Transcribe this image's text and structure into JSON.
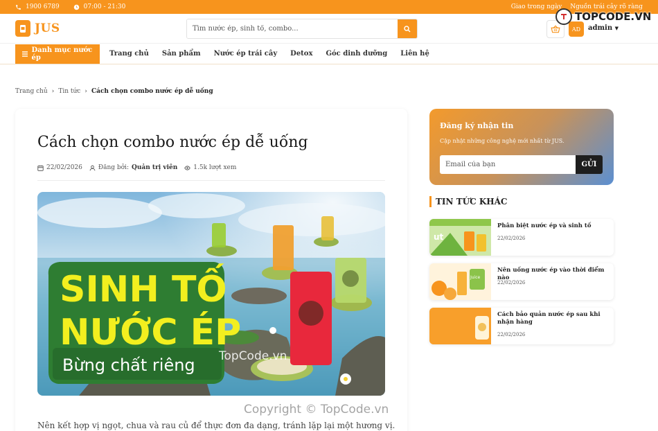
{
  "topbar": {
    "phone": "1900 6789",
    "hours": "07:00 - 21:30",
    "links": [
      "Giao trong ngày",
      "Nguồn trái cây rõ ràng"
    ]
  },
  "header": {
    "brand": "JUS",
    "search_placeholder": "Tìm nước ép, sinh tố, combo...",
    "avatar_initials": "AD",
    "user_name": "admin"
  },
  "nav": {
    "category_button": "Danh mục nước ép",
    "links": [
      "Trang chủ",
      "Sản phẩm",
      "Nước ép trái cây",
      "Detox",
      "Góc dinh dưỡng",
      "Liên hệ"
    ]
  },
  "breadcrumb": {
    "items": [
      "Trang chủ",
      "Tin tức"
    ],
    "current": "Cách chọn combo nước ép dễ uống"
  },
  "article": {
    "title": "Cách chọn combo nước ép dễ uống",
    "date": "22/02/2026",
    "author_label": "Đăng bởi:",
    "author": "Quản trị viên",
    "views": "1.5k lượt xem",
    "hero": {
      "line1": "SINH TỐ",
      "line2": "NƯỚC ÉP",
      "line3": "Bừng chất riêng"
    },
    "body": "Nên kết hợp vị ngọt, chua và rau củ để thực đơn đa dạng, tránh lặp lại một hương vị."
  },
  "sidebar": {
    "newsletter": {
      "title": "Đăng ký nhận tin",
      "subtitle": "Cập nhật những công nghệ mới nhất từ JUS.",
      "email_placeholder": "Email của bạn",
      "button": "GỬI"
    },
    "other_news_title": "TIN TỨC KHÁC",
    "news": [
      {
        "title": "Phân biệt nước ép và sinh tố",
        "date": "22/02/2026"
      },
      {
        "title": "Nên uống nước ép vào thời điểm nào",
        "date": "22/02/2026"
      },
      {
        "title": "Cách bảo quản nước ép sau khi nhận hàng",
        "date": "22/02/2026"
      }
    ]
  },
  "watermark": {
    "logo_text": "TOPCODE.VN",
    "image_text": "TopCode.vn",
    "copyright": "Copyright © TopCode.vn"
  },
  "colors": {
    "accent": "#f7941d",
    "hero_green": "#2e7d32",
    "hero_yellow": "#f2ef1f",
    "dark_button": "#1e1e1e"
  },
  "icons": [
    "phone-icon",
    "clock-icon",
    "cup-icon",
    "search-icon",
    "basket-icon",
    "caret-down-icon",
    "menu-icon",
    "chevron-right-icon",
    "calendar-icon",
    "user-icon",
    "eye-icon"
  ]
}
